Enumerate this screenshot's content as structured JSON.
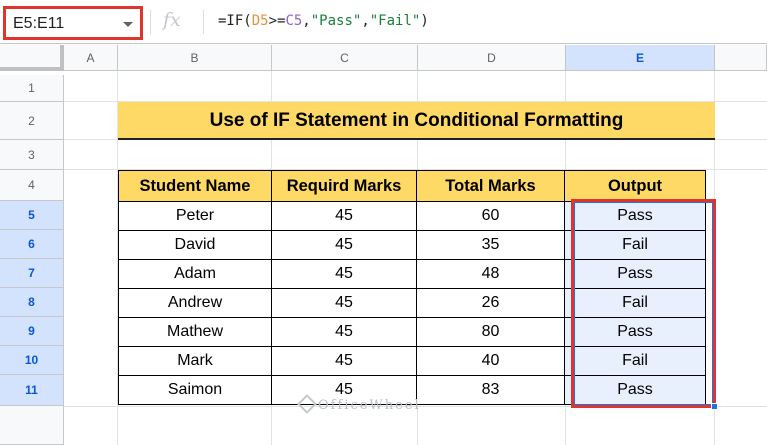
{
  "formula_bar": {
    "name_box": "E5:E11",
    "fx_label": "fx",
    "formula_prefix": "=IF(",
    "formula_ref1": "D5",
    "formula_op": ">=",
    "formula_ref2": "C5",
    "formula_comma1": ",",
    "formula_str1": "\"Pass\"",
    "formula_comma2": ",",
    "formula_str2": "\"Fail\"",
    "formula_suffix": ")"
  },
  "columns": [
    "A",
    "B",
    "C",
    "D",
    "E"
  ],
  "rows": [
    "1",
    "2",
    "3",
    "4",
    "5",
    "6",
    "7",
    "8",
    "9",
    "10",
    "11"
  ],
  "title": "Use of IF Statement in Conditional Formatting",
  "table": {
    "headers": [
      "Student Name",
      "Requird Marks",
      "Total Marks",
      "Output"
    ],
    "rows": [
      [
        "Peter",
        "45",
        "60",
        "Pass"
      ],
      [
        "David",
        "45",
        "35",
        "Fail"
      ],
      [
        "Adam",
        "45",
        "48",
        "Pass"
      ],
      [
        "Andrew",
        "45",
        "26",
        "Fail"
      ],
      [
        "Mathew",
        "45",
        "80",
        "Pass"
      ],
      [
        "Mark",
        "45",
        "40",
        "Fail"
      ],
      [
        "Saimon",
        "45",
        "83",
        "Pass"
      ]
    ]
  },
  "watermark": "OfficeWheel",
  "colors": {
    "title_fill": "#ffd966",
    "selection": "#1a73e8",
    "highlight_box": "#e0352b"
  }
}
